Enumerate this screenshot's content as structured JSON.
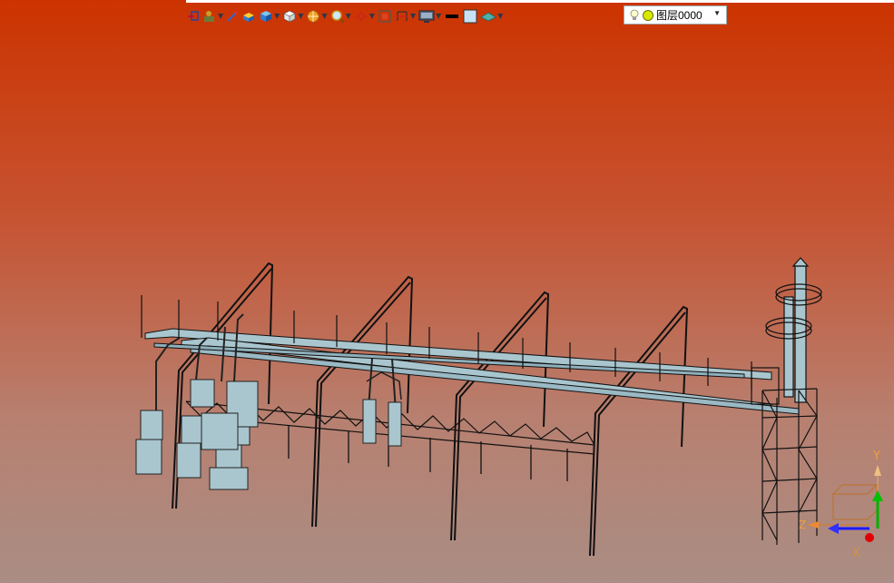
{
  "toolbar": {
    "buttons": [
      {
        "name": "sketch-tool-button",
        "icon": "sketch-icon",
        "dropdown": false
      },
      {
        "name": "select-tool-button",
        "icon": "select-icon",
        "dropdown": true
      },
      {
        "name": "pen-tool-button",
        "icon": "pen-icon",
        "dropdown": false
      },
      {
        "name": "box-tool-button",
        "icon": "box-icon",
        "dropdown": false
      },
      {
        "name": "cube-tool-button",
        "icon": "cube-icon",
        "dropdown": true
      },
      {
        "name": "view-cube-button",
        "icon": "view-cube-icon",
        "dropdown": true
      },
      {
        "name": "render-mode-button",
        "icon": "render-mode-icon",
        "dropdown": true
      },
      {
        "name": "zoom-button",
        "icon": "zoom-icon",
        "dropdown": true
      },
      {
        "name": "snap-button",
        "icon": "snap-icon",
        "dropdown": true
      },
      {
        "name": "fit-button",
        "icon": "fit-icon",
        "dropdown": false
      },
      {
        "name": "section-button",
        "icon": "section-icon",
        "dropdown": true
      },
      {
        "name": "display-button",
        "icon": "monitor-icon",
        "dropdown": true
      },
      {
        "name": "line-color-button",
        "icon": "line-color-icon",
        "dropdown": false
      },
      {
        "name": "fill-color-button",
        "icon": "fill-color-icon",
        "dropdown": false
      },
      {
        "name": "material-button",
        "icon": "material-icon",
        "dropdown": true
      }
    ],
    "layer": {
      "label": "图层0000",
      "icons": [
        "lightbulb-icon",
        "layer-visible-icon"
      ]
    }
  },
  "colors": {
    "background_top": "#cc3300",
    "background_bottom": "#aa8d84",
    "model_fill": "#a9c6cf",
    "model_edge": "#1a1a1a",
    "axis_x": "#e00000",
    "axis_y": "#00b000",
    "axis_z": "#1a1aff"
  },
  "axes": {
    "x": "X",
    "y": "Y",
    "z": "Z"
  }
}
